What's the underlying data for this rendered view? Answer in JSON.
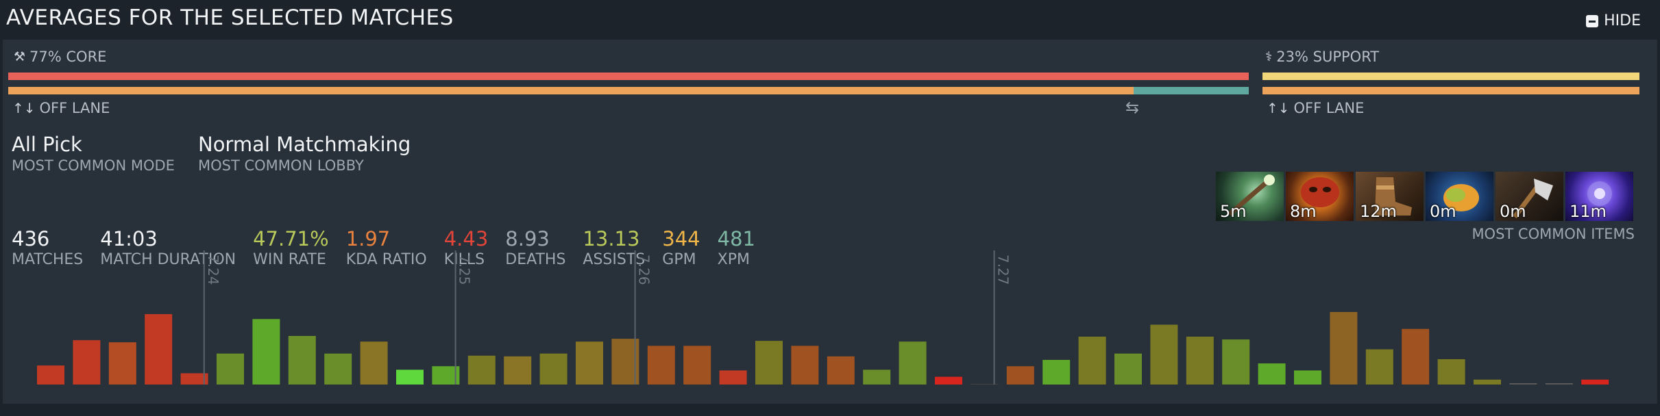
{
  "header": {
    "title": "AVERAGES FOR THE SELECTED MATCHES",
    "hide_label": "HIDE"
  },
  "roles": {
    "core": {
      "label": "77% CORE",
      "percent": 77,
      "lane": "OFF LANE",
      "color": "#e8625a",
      "lane_bar": {
        "primary_fraction": 0.907,
        "primary_color": "#eea35a",
        "secondary_color": "#5fa8a0"
      }
    },
    "support": {
      "label": "23% SUPPORT",
      "percent": 23,
      "lane": "OFF LANE",
      "color": "#f2d77a",
      "lane_bar": {
        "primary_fraction": 1.0,
        "primary_color": "#eea35a"
      }
    }
  },
  "mode": {
    "value": "All Pick",
    "label": "MOST COMMON MODE"
  },
  "lobby": {
    "value": "Normal Matchmaking",
    "label": "MOST COMMON LOBBY"
  },
  "stats": [
    {
      "value": "436",
      "label": "MATCHES",
      "color": "#f2f4f6"
    },
    {
      "value": "41:03",
      "label": "MATCH DURATION",
      "color": "#f2f4f6"
    },
    {
      "value": "47.71%",
      "label": "WIN RATE",
      "color": "#b9c95a"
    },
    {
      "value": "1.97",
      "label": "KDA RATIO",
      "color": "#e8823e"
    },
    {
      "value": "4.43",
      "label": "KILLS",
      "color": "#e2443a"
    },
    {
      "value": "8.93",
      "label": "DEATHS",
      "color": "#9ea6af"
    },
    {
      "value": "13.13",
      "label": "ASSISTS",
      "color": "#b9c95a"
    },
    {
      "value": "344",
      "label": "GPM",
      "color": "#f0b548"
    },
    {
      "value": "481",
      "label": "XPM",
      "color": "#7fb8a4"
    }
  ],
  "items": {
    "label": "MOST COMMON ITEMS",
    "list": [
      {
        "icon": "magic-wand-item-icon",
        "time": "5m"
      },
      {
        "icon": "mask-item-icon",
        "time": "8m"
      },
      {
        "icon": "boots-item-icon",
        "time": "12m"
      },
      {
        "icon": "mango-item-icon",
        "time": "0m"
      },
      {
        "icon": "quelling-blade-item-icon",
        "time": "0m"
      },
      {
        "icon": "aether-lens-item-icon",
        "time": "11m"
      }
    ]
  },
  "chart_data": {
    "type": "bar",
    "values": [
      27,
      63,
      60,
      100,
      16,
      44,
      93,
      69,
      44,
      61,
      21,
      26,
      41,
      40,
      44,
      61,
      65,
      55,
      55,
      20,
      62,
      55,
      40,
      21,
      61,
      11,
      0,
      26,
      35,
      68,
      44,
      85,
      68,
      64,
      30,
      20,
      103,
      50,
      79,
      36,
      7,
      1,
      1,
      7
    ],
    "colors": [
      "#c23a24",
      "#c23a24",
      "#b44d24",
      "#c23a24",
      "#c23a24",
      "#6a8e2a",
      "#5ea82a",
      "#6a8e2a",
      "#6a8e2a",
      "#8a7426",
      "#5fd83e",
      "#5ea82a",
      "#7a7a24",
      "#8a7426",
      "#7a7a24",
      "#8a7426",
      "#8e6424",
      "#a05220",
      "#a05220",
      "#c23a24",
      "#7a7a24",
      "#a05220",
      "#a05220",
      "#6a8e2a",
      "#6a8e2a",
      "#d8261e",
      "#444444",
      "#a05220",
      "#5ea82a",
      "#7a7a24",
      "#6a8e2a",
      "#7a7a24",
      "#7a7a24",
      "#6a8e2a",
      "#5ea82a",
      "#5ea82a",
      "#8e6424",
      "#7a7a24",
      "#a05220",
      "#7a7a24",
      "#7a7a24",
      "#5a5a5a",
      "#5a5a5a",
      "#d8261e"
    ],
    "patches": [
      {
        "label": "7.24",
        "after_bar": 4
      },
      {
        "label": "7.25",
        "after_bar": 11
      },
      {
        "label": "7.26",
        "after_bar": 16
      },
      {
        "label": "7.27",
        "after_bar": 26
      }
    ]
  }
}
